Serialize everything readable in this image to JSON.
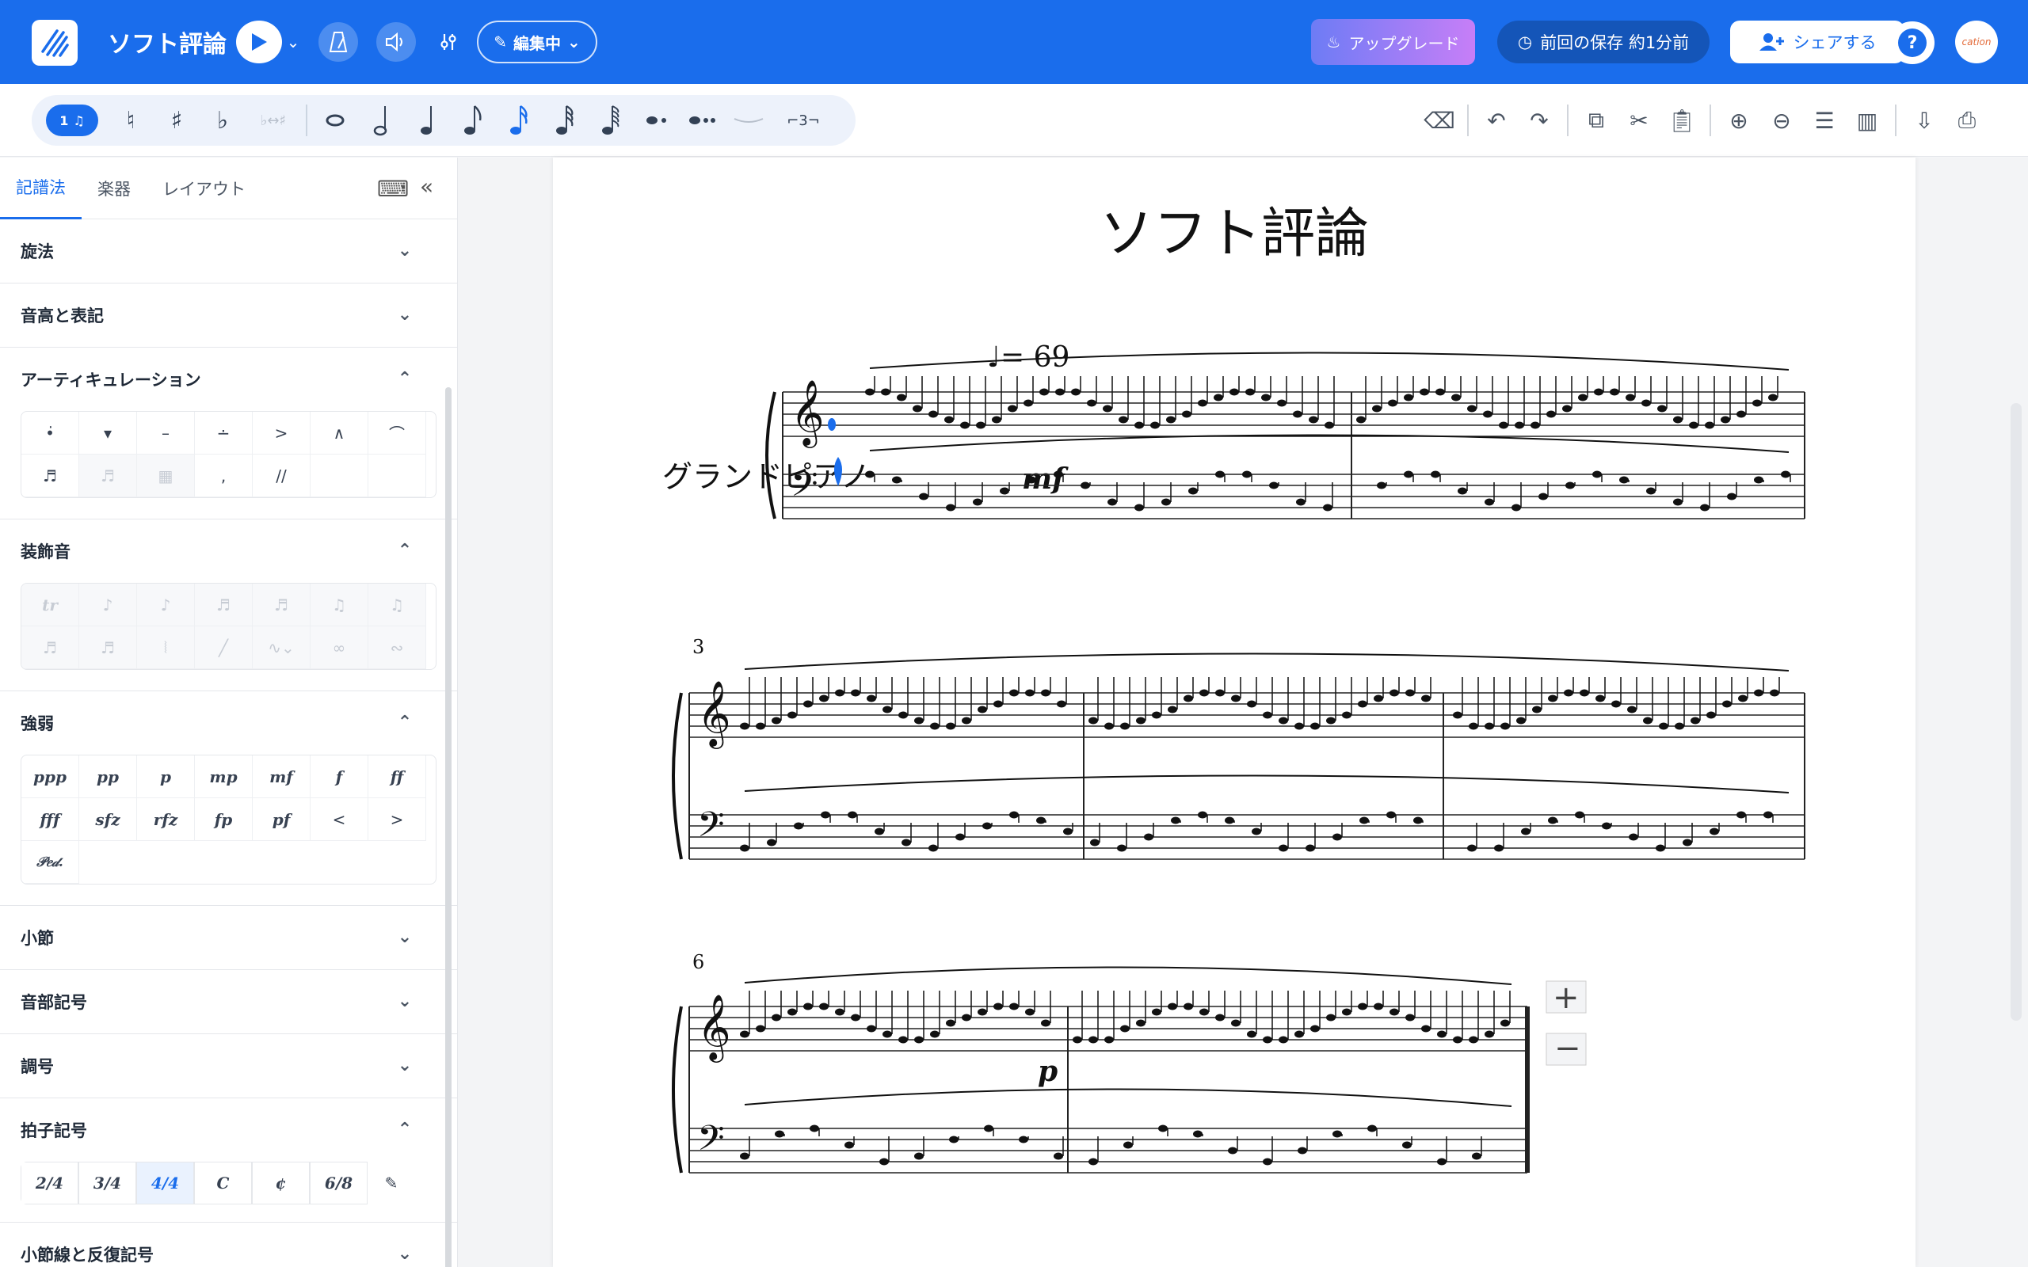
{
  "app": {
    "title": "ソフト評論",
    "edit_mode": "編集中",
    "upgrade": "アップグレード",
    "saved": "前回の保存 約1分前",
    "share": "シェアする",
    "help": "?",
    "avatar": "cation"
  },
  "notes_toolbar": {
    "voice": "1",
    "items": [
      "♮",
      "♯",
      "♭",
      "♭↔♯",
      "𝅝",
      "𝅗𝅥",
      "♩",
      "♪",
      "♬",
      "32nd",
      "64th",
      "dot",
      "double-dot",
      "tie",
      "⌐3¬"
    ],
    "selected": "16th"
  },
  "right_tools": [
    "delete-icon",
    "undo-icon",
    "redo-icon",
    "copy-icon",
    "cut-icon",
    "paste-icon",
    "zoom-in-icon",
    "zoom-out-icon",
    "view-icon",
    "piano-icon",
    "export-icon",
    "print-icon"
  ],
  "sidebar": {
    "tabs": [
      "記譜法",
      "楽器",
      "レイアウト"
    ],
    "active_tab": "記譜法",
    "sections": {
      "melody": "旋法",
      "pitch": "音高と表記",
      "articulation": "アーティキュレーション",
      "ornaments": "装飾音",
      "dynamics": "強弱",
      "measures": "小節",
      "clefs": "音部記号",
      "keys": "調号",
      "time": "拍子記号",
      "barlines": "小節線と反復記号"
    },
    "dynamics": [
      "ppp",
      "pp",
      "p",
      "mp",
      "mf",
      "f",
      "ff",
      "fff",
      "sfz",
      "rfz",
      "fp",
      "pf",
      "<",
      ">",
      "𝒫𝑒𝒹."
    ],
    "time_sigs": [
      "2/4",
      "3/4",
      "4/4",
      "C",
      "¢",
      "6/8"
    ],
    "time_selected": "4/4"
  },
  "score": {
    "title": "ソフト評論",
    "part": "グランドピアノ",
    "tempo": "♩= 69",
    "dynamic_mf": "mf",
    "dynamic_p": "p",
    "measure_3": "3",
    "measure_6": "6",
    "tempo_value": 69
  }
}
